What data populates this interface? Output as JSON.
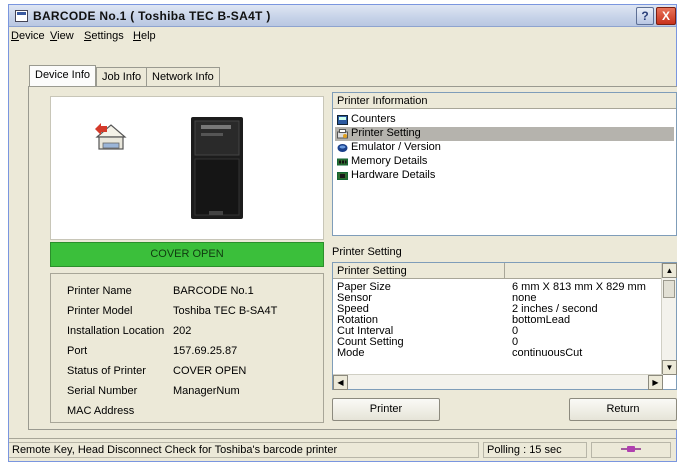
{
  "window": {
    "title": "BARCODE No.1 ( Toshiba TEC B-SA4T )"
  },
  "title_buttons": {
    "help": "?",
    "close": "X"
  },
  "menu": [
    "Device",
    "View",
    "Settings",
    "Help"
  ],
  "tabs": [
    {
      "label": "Device Info",
      "active": true
    },
    {
      "label": "Job Info",
      "active": false
    },
    {
      "label": "Network Info",
      "active": false
    }
  ],
  "device_status": {
    "text": "COVER OPEN",
    "color": "#3bbf3b"
  },
  "printer_info": [
    {
      "label": "Printer Name",
      "value": "BARCODE No.1"
    },
    {
      "label": "Printer Model",
      "value": "Toshiba TEC B-SA4T"
    },
    {
      "label": "Installation Location",
      "value": "202"
    },
    {
      "label": "Port",
      "value": "157.69.25.87"
    },
    {
      "label": "Status of Printer",
      "value": "COVER OPEN"
    },
    {
      "label": "Serial Number",
      "value": "ManagerNum"
    },
    {
      "label": "MAC Address",
      "value": ""
    }
  ],
  "tree": {
    "header": "Printer Information",
    "items": [
      {
        "label": "Counters",
        "icon": "counter-icon",
        "selected": false
      },
      {
        "label": "Printer Setting",
        "icon": "printer-setting-icon",
        "selected": true
      },
      {
        "label": "Emulator / Version",
        "icon": "emulator-icon",
        "selected": false
      },
      {
        "label": "Memory Details",
        "icon": "memory-icon",
        "selected": false
      },
      {
        "label": "Hardware Details",
        "icon": "hardware-icon",
        "selected": false
      }
    ]
  },
  "settings": {
    "section_label": "Printer Setting",
    "columns": [
      "Printer Setting",
      ""
    ],
    "rows": [
      {
        "key": "Paper Size",
        "value": "6 mm X 813 mm X 829 mm"
      },
      {
        "key": "Sensor",
        "value": "none"
      },
      {
        "key": "Speed",
        "value": "2 inches / second"
      },
      {
        "key": "Rotation",
        "value": "bottomLead"
      },
      {
        "key": "Cut Interval",
        "value": "0"
      },
      {
        "key": "Count Setting",
        "value": "0"
      },
      {
        "key": "Mode",
        "value": "continuousCut"
      }
    ]
  },
  "buttons": {
    "printer": "Printer",
    "return": "Return"
  },
  "statusbar": {
    "message": "Remote Key, Head Disconnect Check for Toshiba's barcode printer",
    "polling": "Polling : 15 sec"
  }
}
